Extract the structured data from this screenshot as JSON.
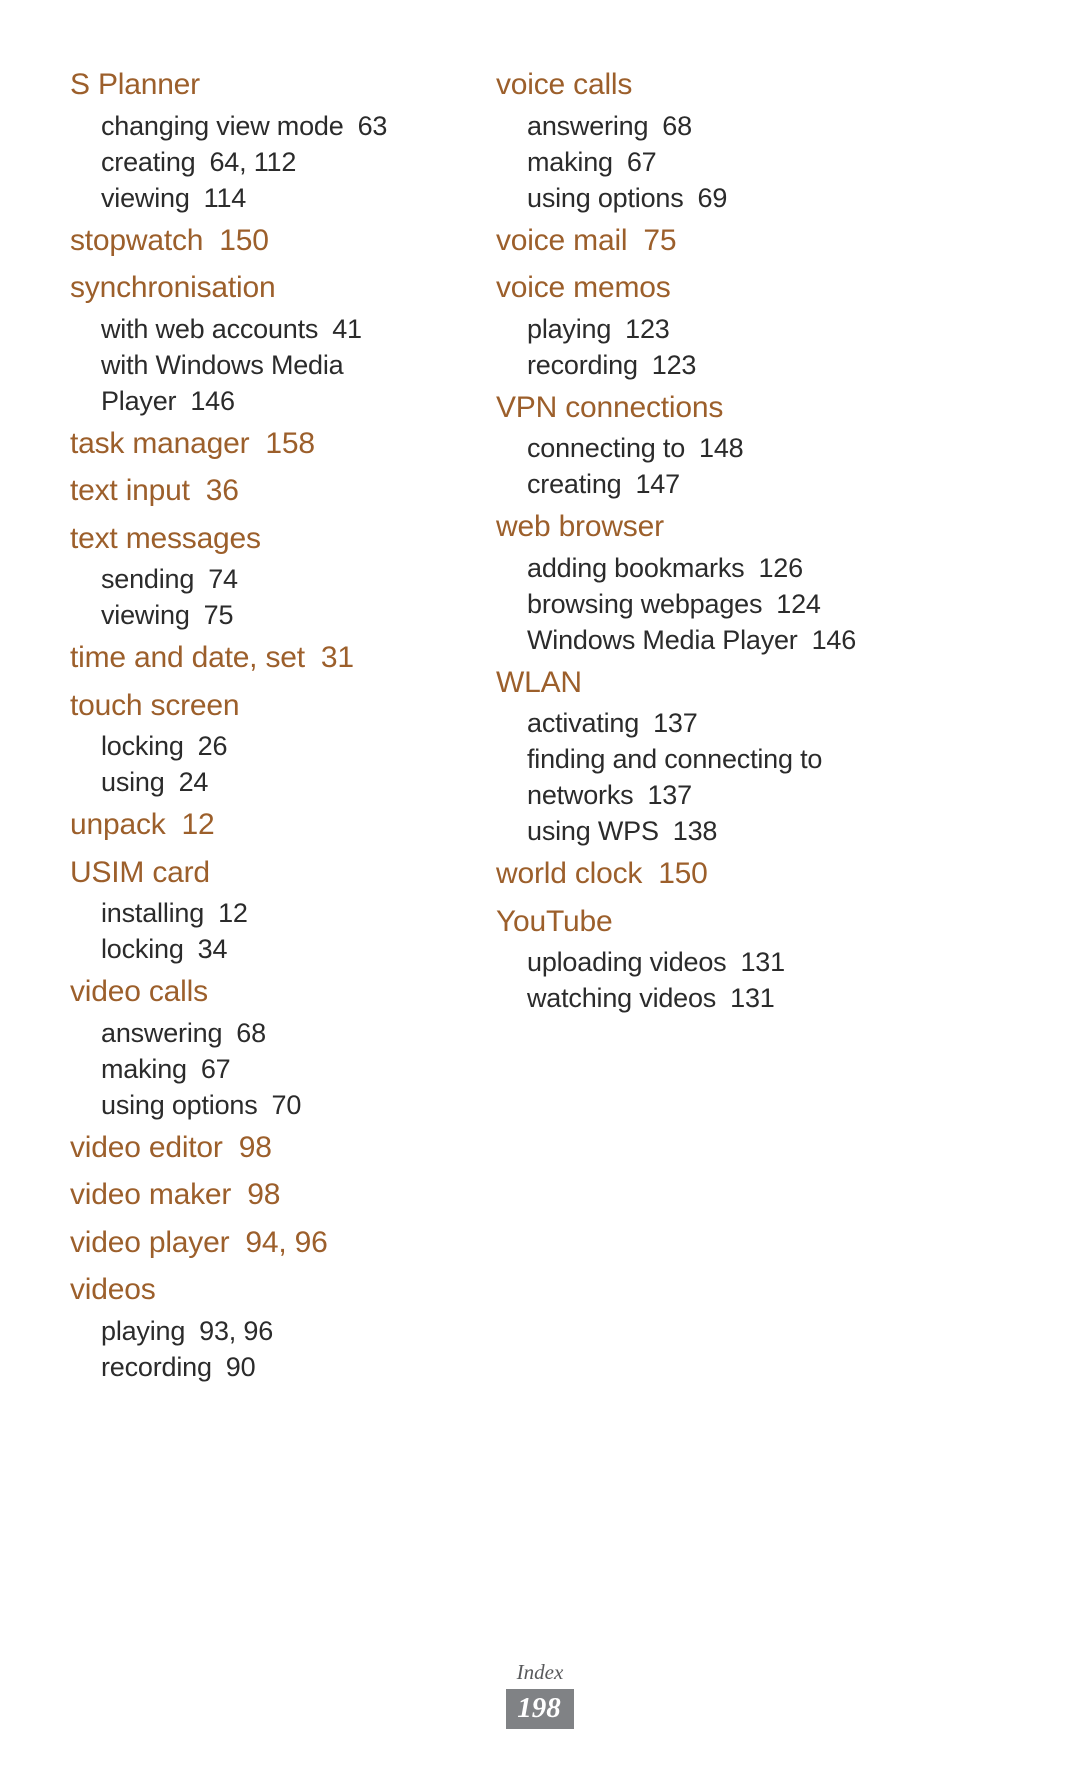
{
  "document": {
    "type": "index-page",
    "footer_label": "Index",
    "page_number": "198",
    "heading_color": "#9c5f2b",
    "subitem_color": "#2b2b2b",
    "page_badge_bg": "#808285"
  },
  "left_column": [
    {
      "term": "S Planner",
      "pages": "",
      "subitems": [
        {
          "label": "changing view mode",
          "pages": "63"
        },
        {
          "label": "creating",
          "pages": "64, 112"
        },
        {
          "label": "viewing",
          "pages": "114"
        }
      ]
    },
    {
      "term": "stopwatch",
      "pages": "150",
      "subitems": []
    },
    {
      "term": "synchronisation",
      "pages": "",
      "subitems": [
        {
          "label": "with web accounts",
          "pages": "41"
        },
        {
          "label": "with Windows Media",
          "pages": ""
        },
        {
          "label": "Player",
          "pages": "146"
        }
      ]
    },
    {
      "term": "task manager",
      "pages": "158",
      "subitems": []
    },
    {
      "term": "text input",
      "pages": "36",
      "subitems": []
    },
    {
      "term": "text messages",
      "pages": "",
      "subitems": [
        {
          "label": "sending",
          "pages": "74"
        },
        {
          "label": "viewing",
          "pages": "75"
        }
      ]
    },
    {
      "term": "time and date, set",
      "pages": "31",
      "subitems": []
    },
    {
      "term": "touch screen",
      "pages": "",
      "subitems": [
        {
          "label": "locking",
          "pages": "26"
        },
        {
          "label": "using",
          "pages": "24"
        }
      ]
    },
    {
      "term": "unpack",
      "pages": "12",
      "subitems": []
    },
    {
      "term": "USIM card",
      "pages": "",
      "subitems": [
        {
          "label": "installing",
          "pages": "12"
        },
        {
          "label": "locking",
          "pages": "34"
        }
      ]
    },
    {
      "term": "video calls",
      "pages": "",
      "subitems": [
        {
          "label": "answering",
          "pages": "68"
        },
        {
          "label": "making",
          "pages": "67"
        },
        {
          "label": "using options",
          "pages": "70"
        }
      ]
    },
    {
      "term": "video editor",
      "pages": "98",
      "subitems": []
    },
    {
      "term": "video maker",
      "pages": "98",
      "subitems": []
    },
    {
      "term": "video player",
      "pages": "94, 96",
      "subitems": []
    },
    {
      "term": "videos",
      "pages": "",
      "subitems": [
        {
          "label": "playing",
          "pages": "93, 96"
        },
        {
          "label": "recording",
          "pages": "90"
        }
      ]
    }
  ],
  "right_column": [
    {
      "term": "voice calls",
      "pages": "",
      "subitems": [
        {
          "label": "answering",
          "pages": "68"
        },
        {
          "label": "making",
          "pages": "67"
        },
        {
          "label": "using options",
          "pages": "69"
        }
      ]
    },
    {
      "term": "voice mail",
      "pages": "75",
      "subitems": []
    },
    {
      "term": "voice memos",
      "pages": "",
      "subitems": [
        {
          "label": "playing",
          "pages": "123"
        },
        {
          "label": "recording",
          "pages": "123"
        }
      ]
    },
    {
      "term": "VPN connections",
      "pages": "",
      "subitems": [
        {
          "label": "connecting to",
          "pages": "148"
        },
        {
          "label": "creating",
          "pages": "147"
        }
      ]
    },
    {
      "term": "web browser",
      "pages": "",
      "subitems": [
        {
          "label": "adding bookmarks",
          "pages": "126"
        },
        {
          "label": "browsing webpages",
          "pages": "124"
        },
        {
          "label": "Windows Media Player",
          "pages": "146"
        }
      ]
    },
    {
      "term": "WLAN",
      "pages": "",
      "subitems": [
        {
          "label": "activating",
          "pages": "137"
        },
        {
          "label": "finding and connecting to",
          "pages": ""
        },
        {
          "label": "networks",
          "pages": "137"
        },
        {
          "label": "using WPS",
          "pages": "138"
        }
      ]
    },
    {
      "term": "world clock",
      "pages": "150",
      "subitems": []
    },
    {
      "term": "YouTube",
      "pages": "",
      "subitems": [
        {
          "label": "uploading videos",
          "pages": "131"
        },
        {
          "label": "watching videos",
          "pages": "131"
        }
      ]
    }
  ]
}
